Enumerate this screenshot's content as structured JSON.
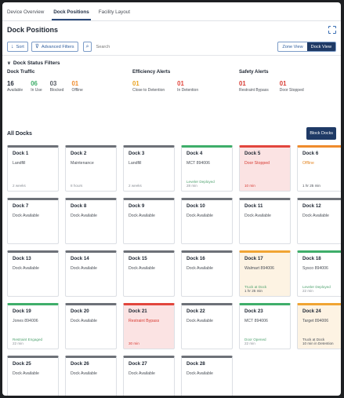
{
  "tabs": [
    "Device Overview",
    "Dock Positions",
    "Facility Layout"
  ],
  "active_tab": 1,
  "page_title": "Dock Positions",
  "toolbar": {
    "sort_label": "Sort",
    "filter_label": "Advanced Filters",
    "search_placeholder": "Search",
    "zone_view_label": "Zone View",
    "dock_view_label": "Dock View"
  },
  "filters": {
    "title": "Dock Status Filters",
    "groups": [
      {
        "title": "Dock Traffic",
        "stats": [
          {
            "value": "16",
            "label": "Available",
            "color": "#1f2733"
          },
          {
            "value": "06",
            "label": "In Use",
            "color": "#3fae6a"
          },
          {
            "value": "03",
            "label": "Blocked",
            "color": "#555a62"
          },
          {
            "value": "01",
            "label": "Offline",
            "color": "#ef8b2c"
          }
        ]
      },
      {
        "title": "Efficiency Alerts",
        "stats": [
          {
            "value": "01",
            "label": "Close to Detention",
            "color": "#e9a21f"
          },
          {
            "value": "01",
            "label": "In Detention",
            "color": "#e2463d"
          }
        ]
      },
      {
        "title": "Safety Alerts",
        "stats": [
          {
            "value": "01",
            "label": "Restraint Bypass",
            "color": "#d73a32"
          },
          {
            "value": "01",
            "label": "Door Stopped",
            "color": "#d73a32"
          }
        ]
      }
    ]
  },
  "all_docks_title": "All Docks",
  "block_button_label": "Block Docks",
  "docks": [
    {
      "name": "Dock 1",
      "style": "gray",
      "status": "Landfill",
      "status_color": "",
      "note": "",
      "time": "2 weeks"
    },
    {
      "name": "Dock 2",
      "style": "gray",
      "status": "Maintenance",
      "status_color": "",
      "note": "",
      "time": "8 hours"
    },
    {
      "name": "Dock 3",
      "style": "gray",
      "status": "Landfill",
      "status_color": "",
      "note": "",
      "time": "2 weeks"
    },
    {
      "name": "Dock 4",
      "style": "green",
      "status": "MCT 894006",
      "status_color": "",
      "note": "Leveler Deployed",
      "note_color": "",
      "time": "28 min"
    },
    {
      "name": "Dock 5",
      "style": "red",
      "status": "Door Stopped",
      "status_color": "red",
      "note": "",
      "time": "10 min",
      "time_color": "red"
    },
    {
      "name": "Dock 6",
      "style": "orange",
      "status": "Offline",
      "status_color": "orange",
      "note": "",
      "time": "1 hr 25 min",
      "time_color": "dark"
    },
    {
      "name": "Dock 7",
      "style": "gray",
      "status": "Dock Available",
      "status_color": "",
      "note": "",
      "time": ""
    },
    {
      "name": "Dock 8",
      "style": "gray",
      "status": "Dock Available",
      "status_color": "",
      "note": "",
      "time": ""
    },
    {
      "name": "Dock 9",
      "style": "gray",
      "status": "Dock Available",
      "status_color": "",
      "note": "",
      "time": ""
    },
    {
      "name": "Dock 10",
      "style": "gray",
      "status": "Dock Available",
      "status_color": "",
      "note": "",
      "time": ""
    },
    {
      "name": "Dock 11",
      "style": "gray",
      "status": "Dock Available",
      "status_color": "",
      "note": "",
      "time": ""
    },
    {
      "name": "Dock 12",
      "style": "gray",
      "status": "Dock Available",
      "status_color": "",
      "note": "",
      "time": ""
    },
    {
      "name": "Dock 13",
      "style": "gray",
      "status": "Dock Available",
      "status_color": "",
      "note": "",
      "time": ""
    },
    {
      "name": "Dock 14",
      "style": "gray",
      "status": "Dock Available",
      "status_color": "",
      "note": "",
      "time": ""
    },
    {
      "name": "Dock 15",
      "style": "gray",
      "status": "Dock Available",
      "status_color": "",
      "note": "",
      "time": ""
    },
    {
      "name": "Dock 16",
      "style": "gray",
      "status": "Dock Available",
      "status_color": "",
      "note": "",
      "time": ""
    },
    {
      "name": "Dock 17",
      "style": "amber",
      "status": "Walmart 894006",
      "status_color": "",
      "note": "Truck at Dock",
      "note_color": "",
      "time": "1 hr 25 min",
      "time_color": "dark"
    },
    {
      "name": "Dock 18",
      "style": "green",
      "status": "Sysco 894006",
      "status_color": "",
      "note": "Leveler Deployed",
      "note_color": "",
      "time": "22 min"
    },
    {
      "name": "Dock 19",
      "style": "green",
      "status": "Jones 894006",
      "status_color": "",
      "note": "Restraint Engaged",
      "note_color": "",
      "time": "22 min"
    },
    {
      "name": "Dock 20",
      "style": "gray",
      "status": "Dock Available",
      "status_color": "",
      "note": "",
      "time": ""
    },
    {
      "name": "Dock 21",
      "style": "red",
      "status": "Restraint Bypass",
      "status_color": "red",
      "note": "",
      "time": "30 min",
      "time_color": "red"
    },
    {
      "name": "Dock 22",
      "style": "gray",
      "status": "Dock Available",
      "status_color": "",
      "note": "",
      "time": ""
    },
    {
      "name": "Dock 23",
      "style": "green",
      "status": "MCT 894006",
      "status_color": "",
      "note": "Door Opened",
      "note_color": "",
      "time": "22 min"
    },
    {
      "name": "Dock 24",
      "style": "amber",
      "status": "Target 894006",
      "status_color": "",
      "note": "Truck at Dock",
      "note_color": "dark",
      "time": "10 min in Detention",
      "time_color": "dark"
    },
    {
      "name": "Dock 25",
      "style": "gray",
      "status": "Dock Available",
      "status_color": "",
      "note": "",
      "time": ""
    },
    {
      "name": "Dock 26",
      "style": "gray",
      "status": "Dock Available",
      "status_color": "",
      "note": "",
      "time": ""
    },
    {
      "name": "Dock 27",
      "style": "gray",
      "status": "Dock Available",
      "status_color": "",
      "note": "",
      "time": ""
    },
    {
      "name": "Dock 28",
      "style": "gray",
      "status": "Dock Available",
      "status_color": "",
      "note": "",
      "time": ""
    }
  ]
}
